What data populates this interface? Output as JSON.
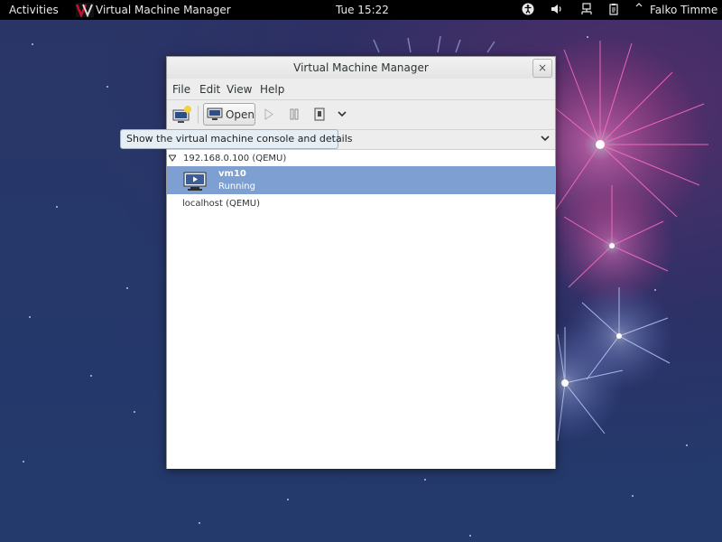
{
  "topbar": {
    "activities": "Activities",
    "app_menu": "Virtual Machine Manager",
    "clock": "Tue 15:22",
    "user": "Falko Timme",
    "icons": [
      "accessibility-icon",
      "volume-icon",
      "network-icon",
      "clipboard-icon"
    ]
  },
  "window": {
    "title": "Virtual Machine Manager",
    "close_label": "×",
    "menu": [
      "File",
      "Edit",
      "View",
      "Help"
    ],
    "toolbar": {
      "open_label": "Open",
      "tooltip": "Show the virtual machine console and details"
    },
    "connections": [
      {
        "label": "192.168.0.100 (QEMU)",
        "vms": [
          {
            "name": "vm10",
            "status": "Running"
          }
        ]
      },
      {
        "label": "localhost (QEMU)"
      }
    ]
  },
  "colors": {
    "selection": "#7e9fd1",
    "desktop": "#26376a",
    "topbar": "#000000"
  }
}
